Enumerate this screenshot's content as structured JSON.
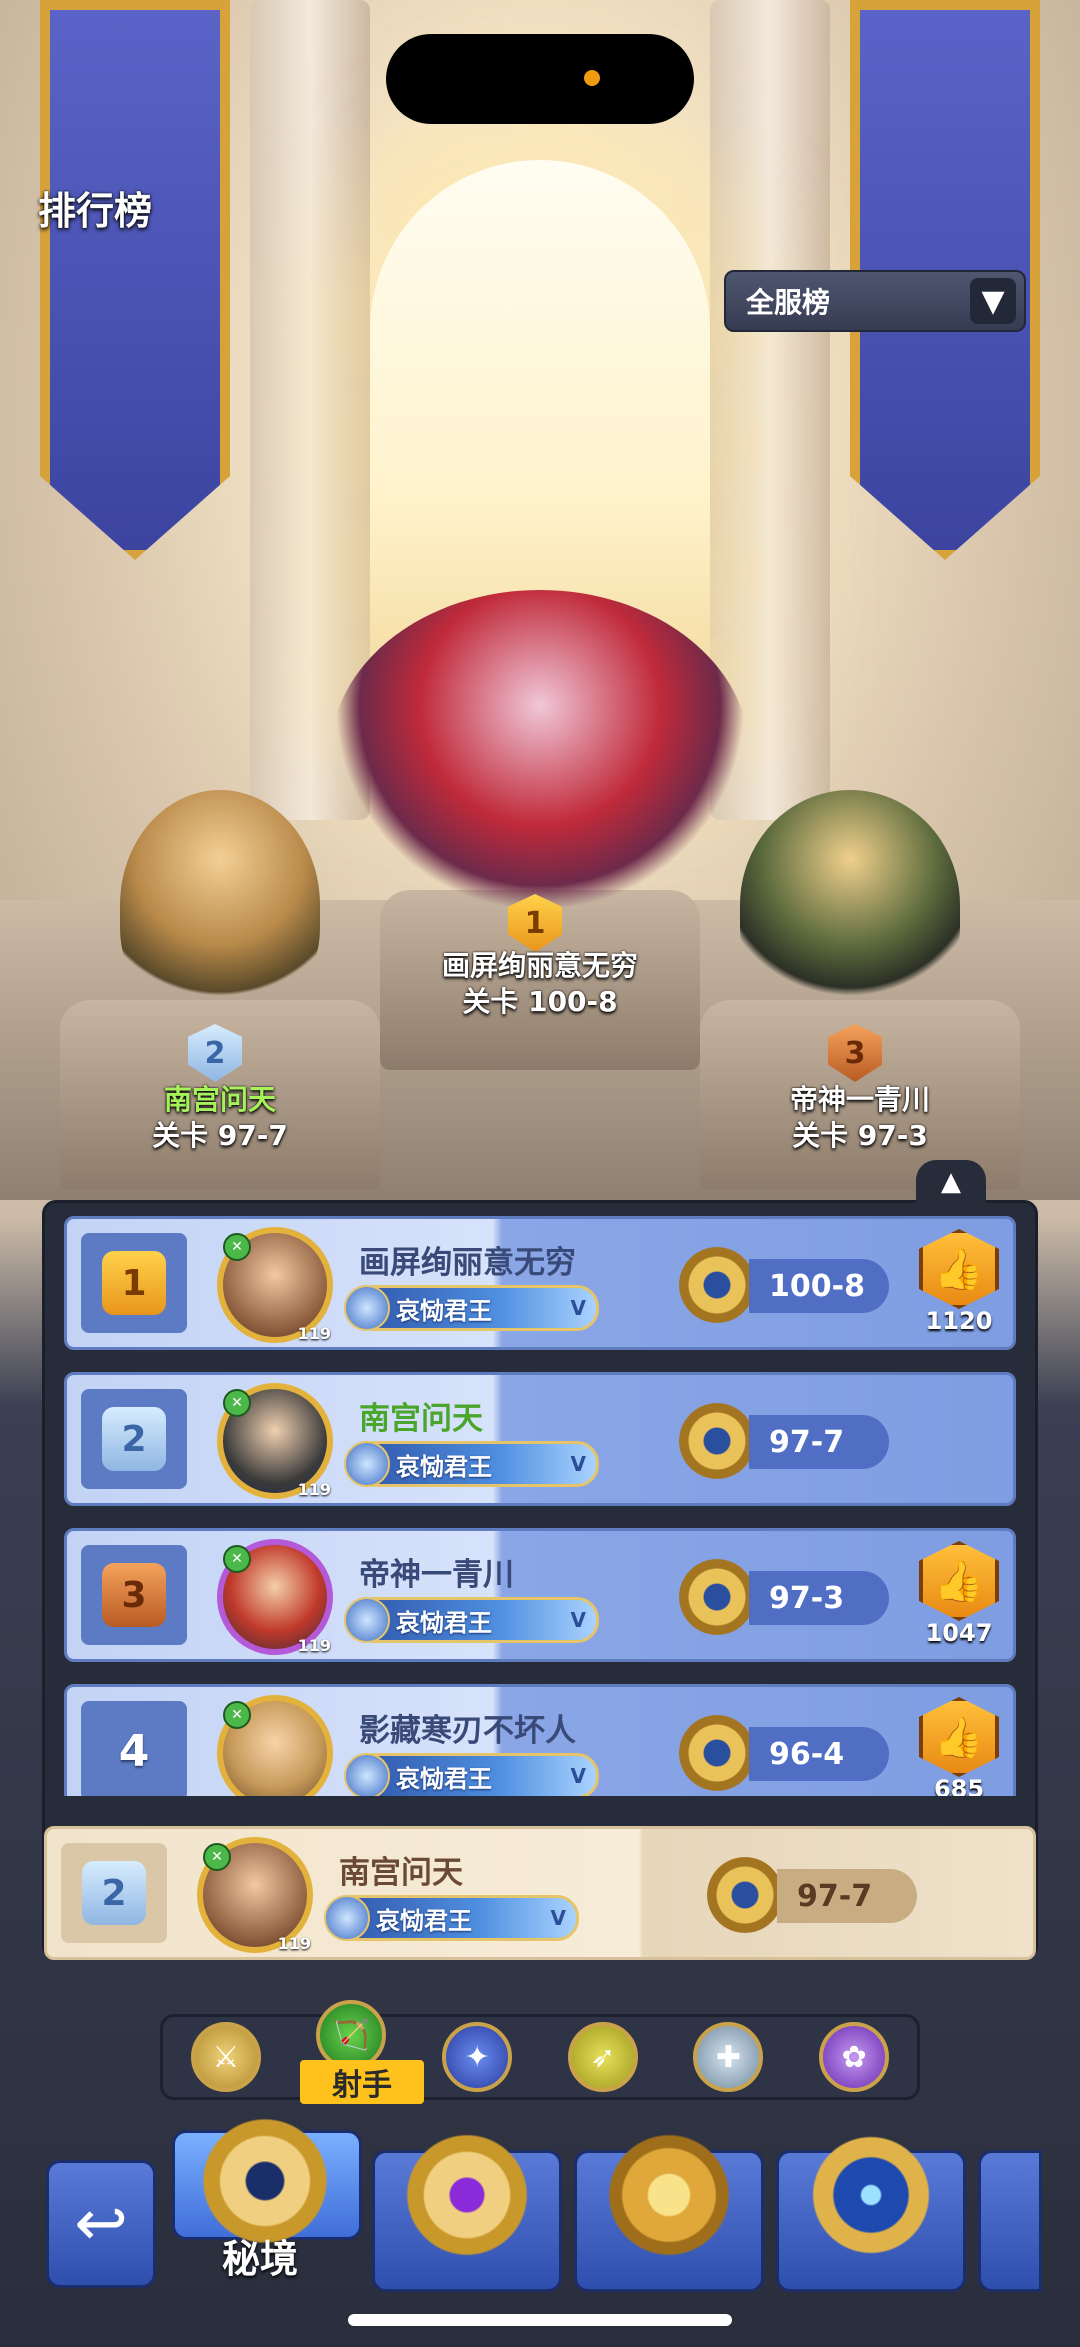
{
  "page_title": "排行榜",
  "scope_dropdown": {
    "selected": "全服榜",
    "icon": "chevron-down-icon"
  },
  "podium": [
    {
      "rank": "2",
      "name": "南宫问天",
      "stage": "关卡 97-7",
      "highlight": true
    },
    {
      "rank": "1",
      "name": "画屏绚丽意无穷",
      "stage": "关卡 100-8",
      "highlight": false
    },
    {
      "rank": "3",
      "name": "帝神一青川",
      "stage": "关卡 97-3",
      "highlight": false
    }
  ],
  "rankings": [
    {
      "rank": "1",
      "name": "画屏绚丽意无穷",
      "title": "哀恸君王",
      "level": "119",
      "stage": "100-8",
      "likes": "1120",
      "highlight": false
    },
    {
      "rank": "2",
      "name": "南宫问天",
      "title": "哀恸君王",
      "level": "119",
      "stage": "97-7",
      "likes": "",
      "highlight": true
    },
    {
      "rank": "3",
      "name": "帝神一青川",
      "title": "哀恸君王",
      "level": "119",
      "stage": "97-3",
      "likes": "1047",
      "highlight": false
    },
    {
      "rank": "4",
      "name": "影藏寒刃不坏人",
      "title": "哀恸君王",
      "level": "",
      "stage": "96-4",
      "likes": "685",
      "highlight": false
    }
  ],
  "title_badge_suffix": "V",
  "my_rank": {
    "rank": "2",
    "name": "南宫问天",
    "title": "哀恸君王",
    "level": "119",
    "stage": "97-7"
  },
  "class_tabs": {
    "selected_label": "射手",
    "items": [
      "warrior-icon",
      "archer-icon",
      "mage-staff-icon",
      "assassin-blade-icon",
      "priest-icon",
      "summoner-icon"
    ],
    "selected_index": 1
  },
  "bottom_nav": {
    "selected_label": "秘境",
    "back_icon": "back-arrow-icon"
  },
  "colors": {
    "accent_gold": "#e3b23c",
    "row_blue": "#7e9de2",
    "my_row": "#f1e4cc",
    "selected_tab": "#ffc21c"
  }
}
